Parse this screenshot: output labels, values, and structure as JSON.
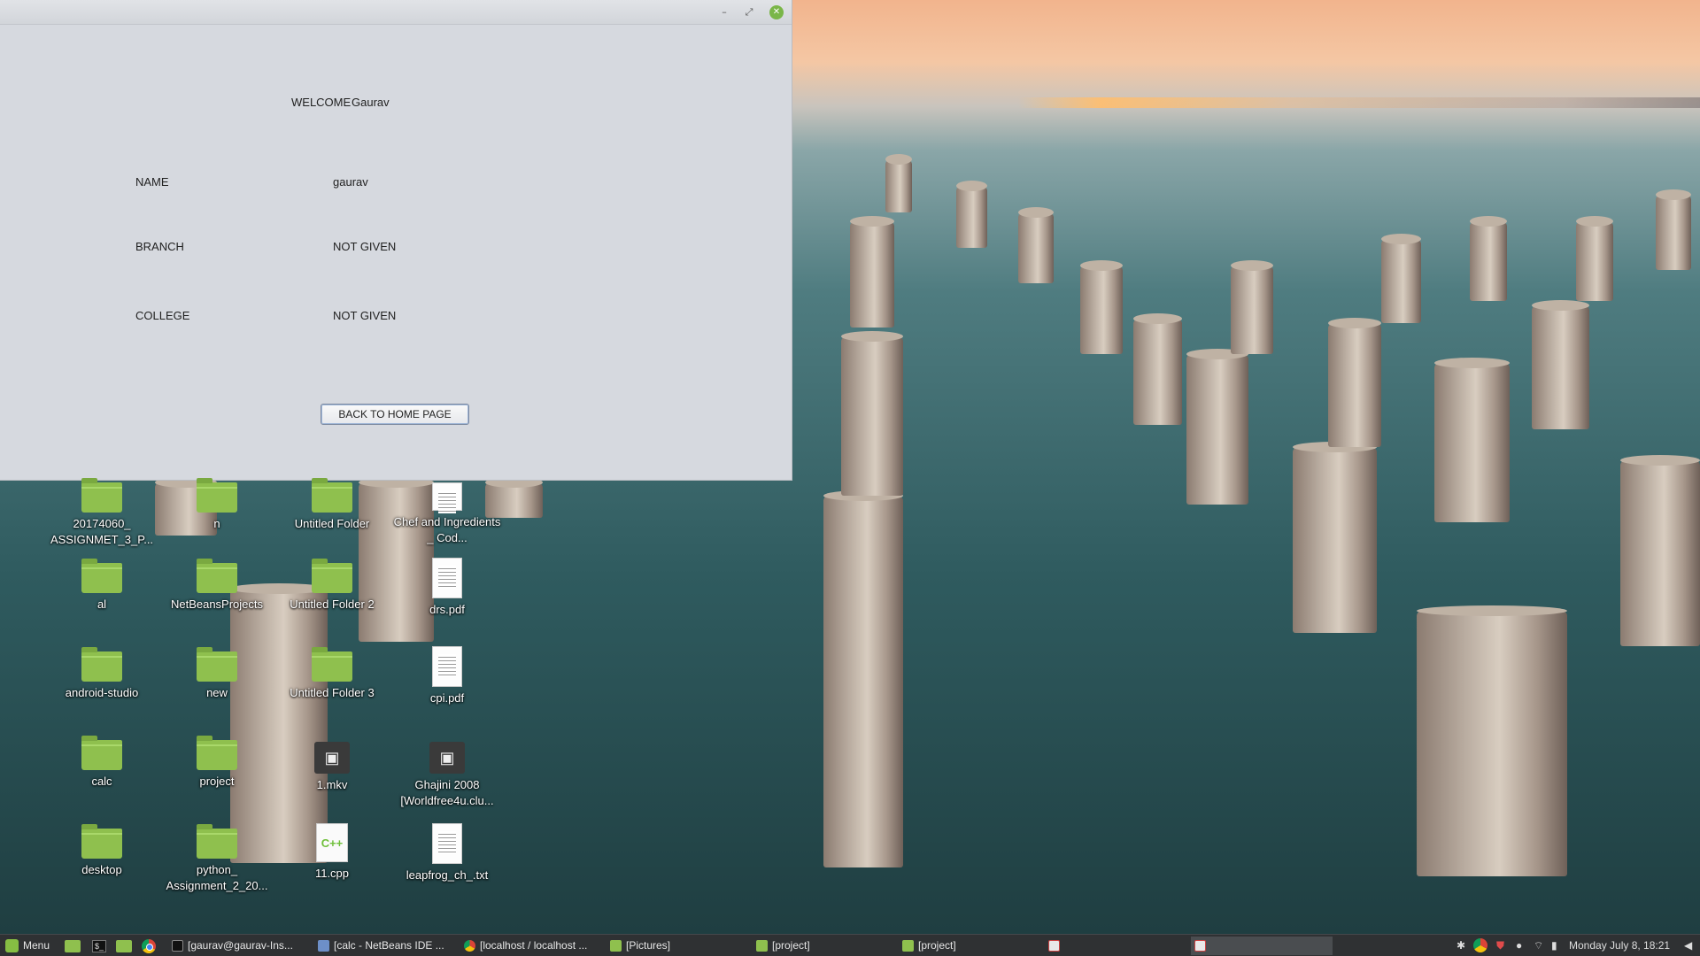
{
  "window": {
    "controls": {
      "minimize": "–",
      "maximize": "⤢",
      "close": "✕"
    },
    "welcome_label": "WELCOME",
    "welcome_name": "Gaurav",
    "fields": [
      {
        "label": "NAME",
        "value": "gaurav"
      },
      {
        "label": "BRANCH",
        "value": "NOT GIVEN"
      },
      {
        "label": "COLLEGE",
        "value": "NOT GIVEN"
      }
    ],
    "back_button_label": "BACK TO HOME PAGE"
  },
  "desktop_icons": [
    {
      "label": "20174060_ ASSIGNMET_3_P...",
      "icon": "folder-icon"
    },
    {
      "label": "n",
      "icon": "folder-icon"
    },
    {
      "label": "Untitled Folder",
      "icon": "folder-icon"
    },
    {
      "label": "Chef and Ingredients _ Cod...",
      "icon": "document-icon"
    },
    {
      "label": "al",
      "icon": "folder-icon"
    },
    {
      "label": "NetBeansProjects",
      "icon": "folder-icon"
    },
    {
      "label": "Untitled Folder 2",
      "icon": "folder-icon"
    },
    {
      "label": "drs.pdf",
      "icon": "pdf-icon"
    },
    {
      "label": "android-studio",
      "icon": "folder-icon"
    },
    {
      "label": "new",
      "icon": "folder-icon"
    },
    {
      "label": "Untitled Folder 3",
      "icon": "folder-icon"
    },
    {
      "label": "cpi.pdf",
      "icon": "pdf-icon"
    },
    {
      "label": "calc",
      "icon": "folder-icon"
    },
    {
      "label": "project",
      "icon": "folder-icon"
    },
    {
      "label": "1.mkv",
      "icon": "video-icon"
    },
    {
      "label": "Ghajini 2008 [Worldfree4u.clu...",
      "icon": "video-icon"
    },
    {
      "label": "desktop",
      "icon": "folder-icon"
    },
    {
      "label": "python_ Assignment_2_20...",
      "icon": "folder-icon"
    },
    {
      "label": "11.cpp",
      "icon": "cpp-file-icon"
    },
    {
      "label": "leapfrog_ch_.txt",
      "icon": "text-file-icon"
    }
  ],
  "taskbar": {
    "menu_label": "Menu",
    "tasks": [
      {
        "label": "[gaurav@gaurav-Ins...",
        "icon": "terminal-icon"
      },
      {
        "label": "[calc - NetBeans IDE ...",
        "icon": "netbeans-icon"
      },
      {
        "label": "[localhost / localhost ...",
        "icon": "chrome-icon"
      },
      {
        "label": "[Pictures]",
        "icon": "folder-icon"
      },
      {
        "label": "[project]",
        "icon": "folder-icon"
      },
      {
        "label": "[project]",
        "icon": "folder-icon"
      },
      {
        "label": "",
        "icon": "java-icon"
      },
      {
        "label": "",
        "icon": "java-icon"
      }
    ],
    "clock": "Monday July  8, 18:21"
  },
  "colors": {
    "window_bg": "#d6d9df",
    "taskbar_bg": "#2f3133",
    "folder_green": "#8fc04e",
    "close_button": "#7ab648"
  }
}
